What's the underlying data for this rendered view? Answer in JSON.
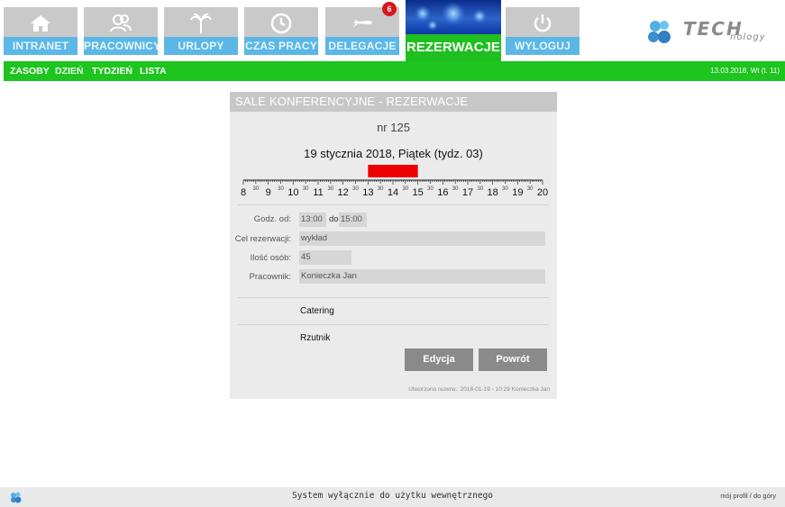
{
  "nav": {
    "items": [
      {
        "label": "INTRANET",
        "icon": "home-icon"
      },
      {
        "label": "PRACOWNICY",
        "icon": "users-icon"
      },
      {
        "label": "URLOPY",
        "icon": "palm-tree-icon"
      },
      {
        "label": "CZAS PRACY",
        "icon": "clock-icon"
      },
      {
        "label": "DELEGACJE",
        "icon": "plane-icon",
        "badge": "6"
      },
      {
        "label": "REZERWACJE",
        "active": true
      },
      {
        "label": "WYLOGUJ",
        "icon": "power-icon"
      }
    ]
  },
  "brand": {
    "logo_text": "TECH",
    "logo_sub": "nology",
    "accent": "#1ec51e",
    "nav_blue": "#5bb7e6"
  },
  "subnav": {
    "links": [
      "ZASOBY",
      "DZIEŃ",
      "TYDZIEŃ",
      "LISTA"
    ],
    "current": "DZIEŃ",
    "date": "13.03.2018, Wt (t. 11)"
  },
  "panel": {
    "title": "SALE KONFERENCYJNE - REZERWACJE",
    "nr": "nr 125",
    "date_heading": "19 stycznia 2018, Piątek (tydz. 03)",
    "timeline": {
      "hours": [
        "8",
        "9",
        "10",
        "11",
        "12",
        "13",
        "14",
        "15",
        "16",
        "17",
        "18",
        "19",
        "20"
      ],
      "half_label": "30",
      "booked_from_hour": 13.0,
      "booked_to_hour": 15.0,
      "booked_color": "#ee0000"
    },
    "form": {
      "from_label": "Godz. od:",
      "from_value": "13:00",
      "to_label": "do",
      "to_value": "15:00",
      "purpose_label": "Cel rezerwacji:",
      "purpose_value": "wykład",
      "people_label": "Ilość osób:",
      "people_value": "45",
      "employee_label": "Pracownik:",
      "employee_value": "Konieczka Jan"
    },
    "options": [
      "Catering",
      "Rzutnik"
    ],
    "buttons": {
      "edit": "Edycja",
      "back": "Powrót"
    },
    "created": "Utworzono rezerw.: 2018-01-19 - 10:29 Konieczka Jan"
  },
  "footer": {
    "notice": "System wyłącznie do użytku wewnętrznego",
    "profile_link": "mój profil",
    "separator": "/",
    "top_link": "do góry"
  }
}
